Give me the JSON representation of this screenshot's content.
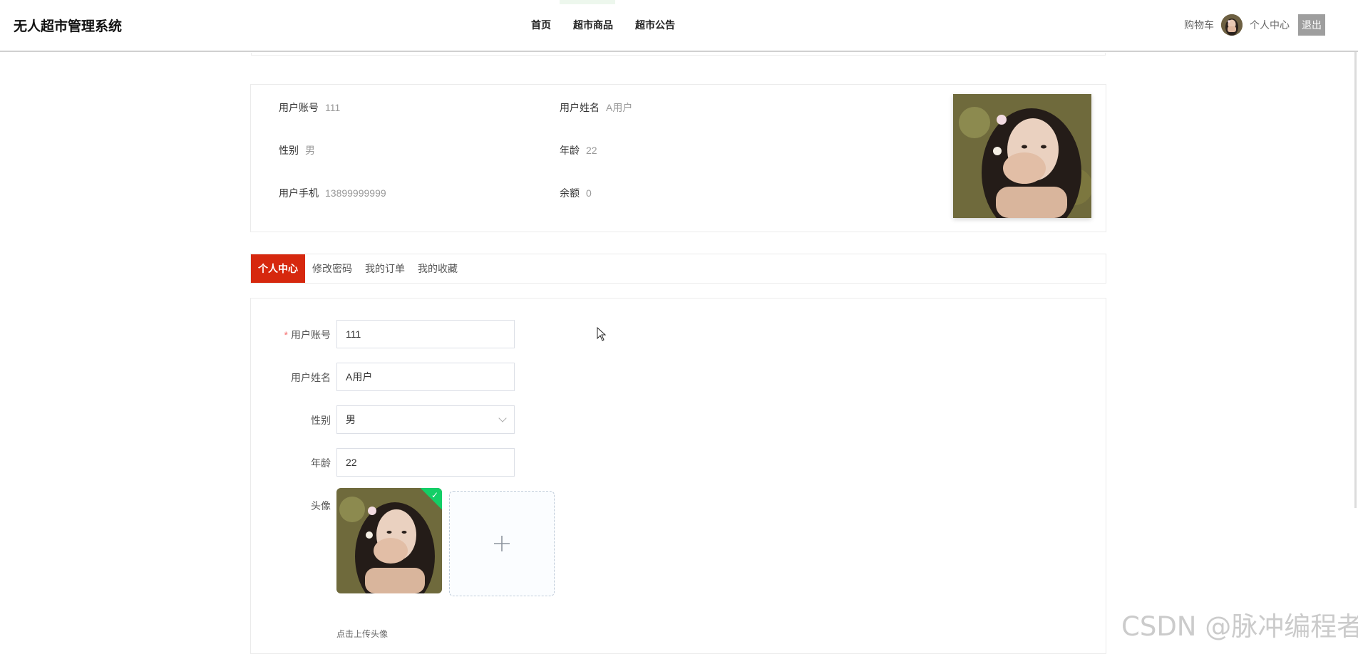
{
  "navbar": {
    "brand": "无人超市管理系统",
    "menu": [
      "首页",
      "超市商品",
      "超市公告"
    ],
    "cart": "购物车",
    "personal_center": "个人中心",
    "logout": "退出"
  },
  "info": {
    "account_label": "用户账号",
    "account_value": "111",
    "name_label": "用户姓名",
    "name_value": "A用户",
    "gender_label": "性别",
    "gender_value": "男",
    "age_label": "年龄",
    "age_value": "22",
    "phone_label": "用户手机",
    "phone_value": "13899999999",
    "balance_label": "余额",
    "balance_value": "0"
  },
  "tabs": [
    "个人中心",
    "修改密码",
    "我的订单",
    "我的收藏"
  ],
  "form": {
    "required_mark": "*",
    "account_label": "用户账号",
    "account_value": "111",
    "name_label": "用户姓名",
    "name_value": "A用户",
    "gender_label": "性别",
    "gender_value": "男",
    "age_label": "年龄",
    "age_value": "22",
    "avatar_label": "头像",
    "upload_tip": "点击上传头像"
  },
  "watermark": "CSDN @脉冲编程者"
}
